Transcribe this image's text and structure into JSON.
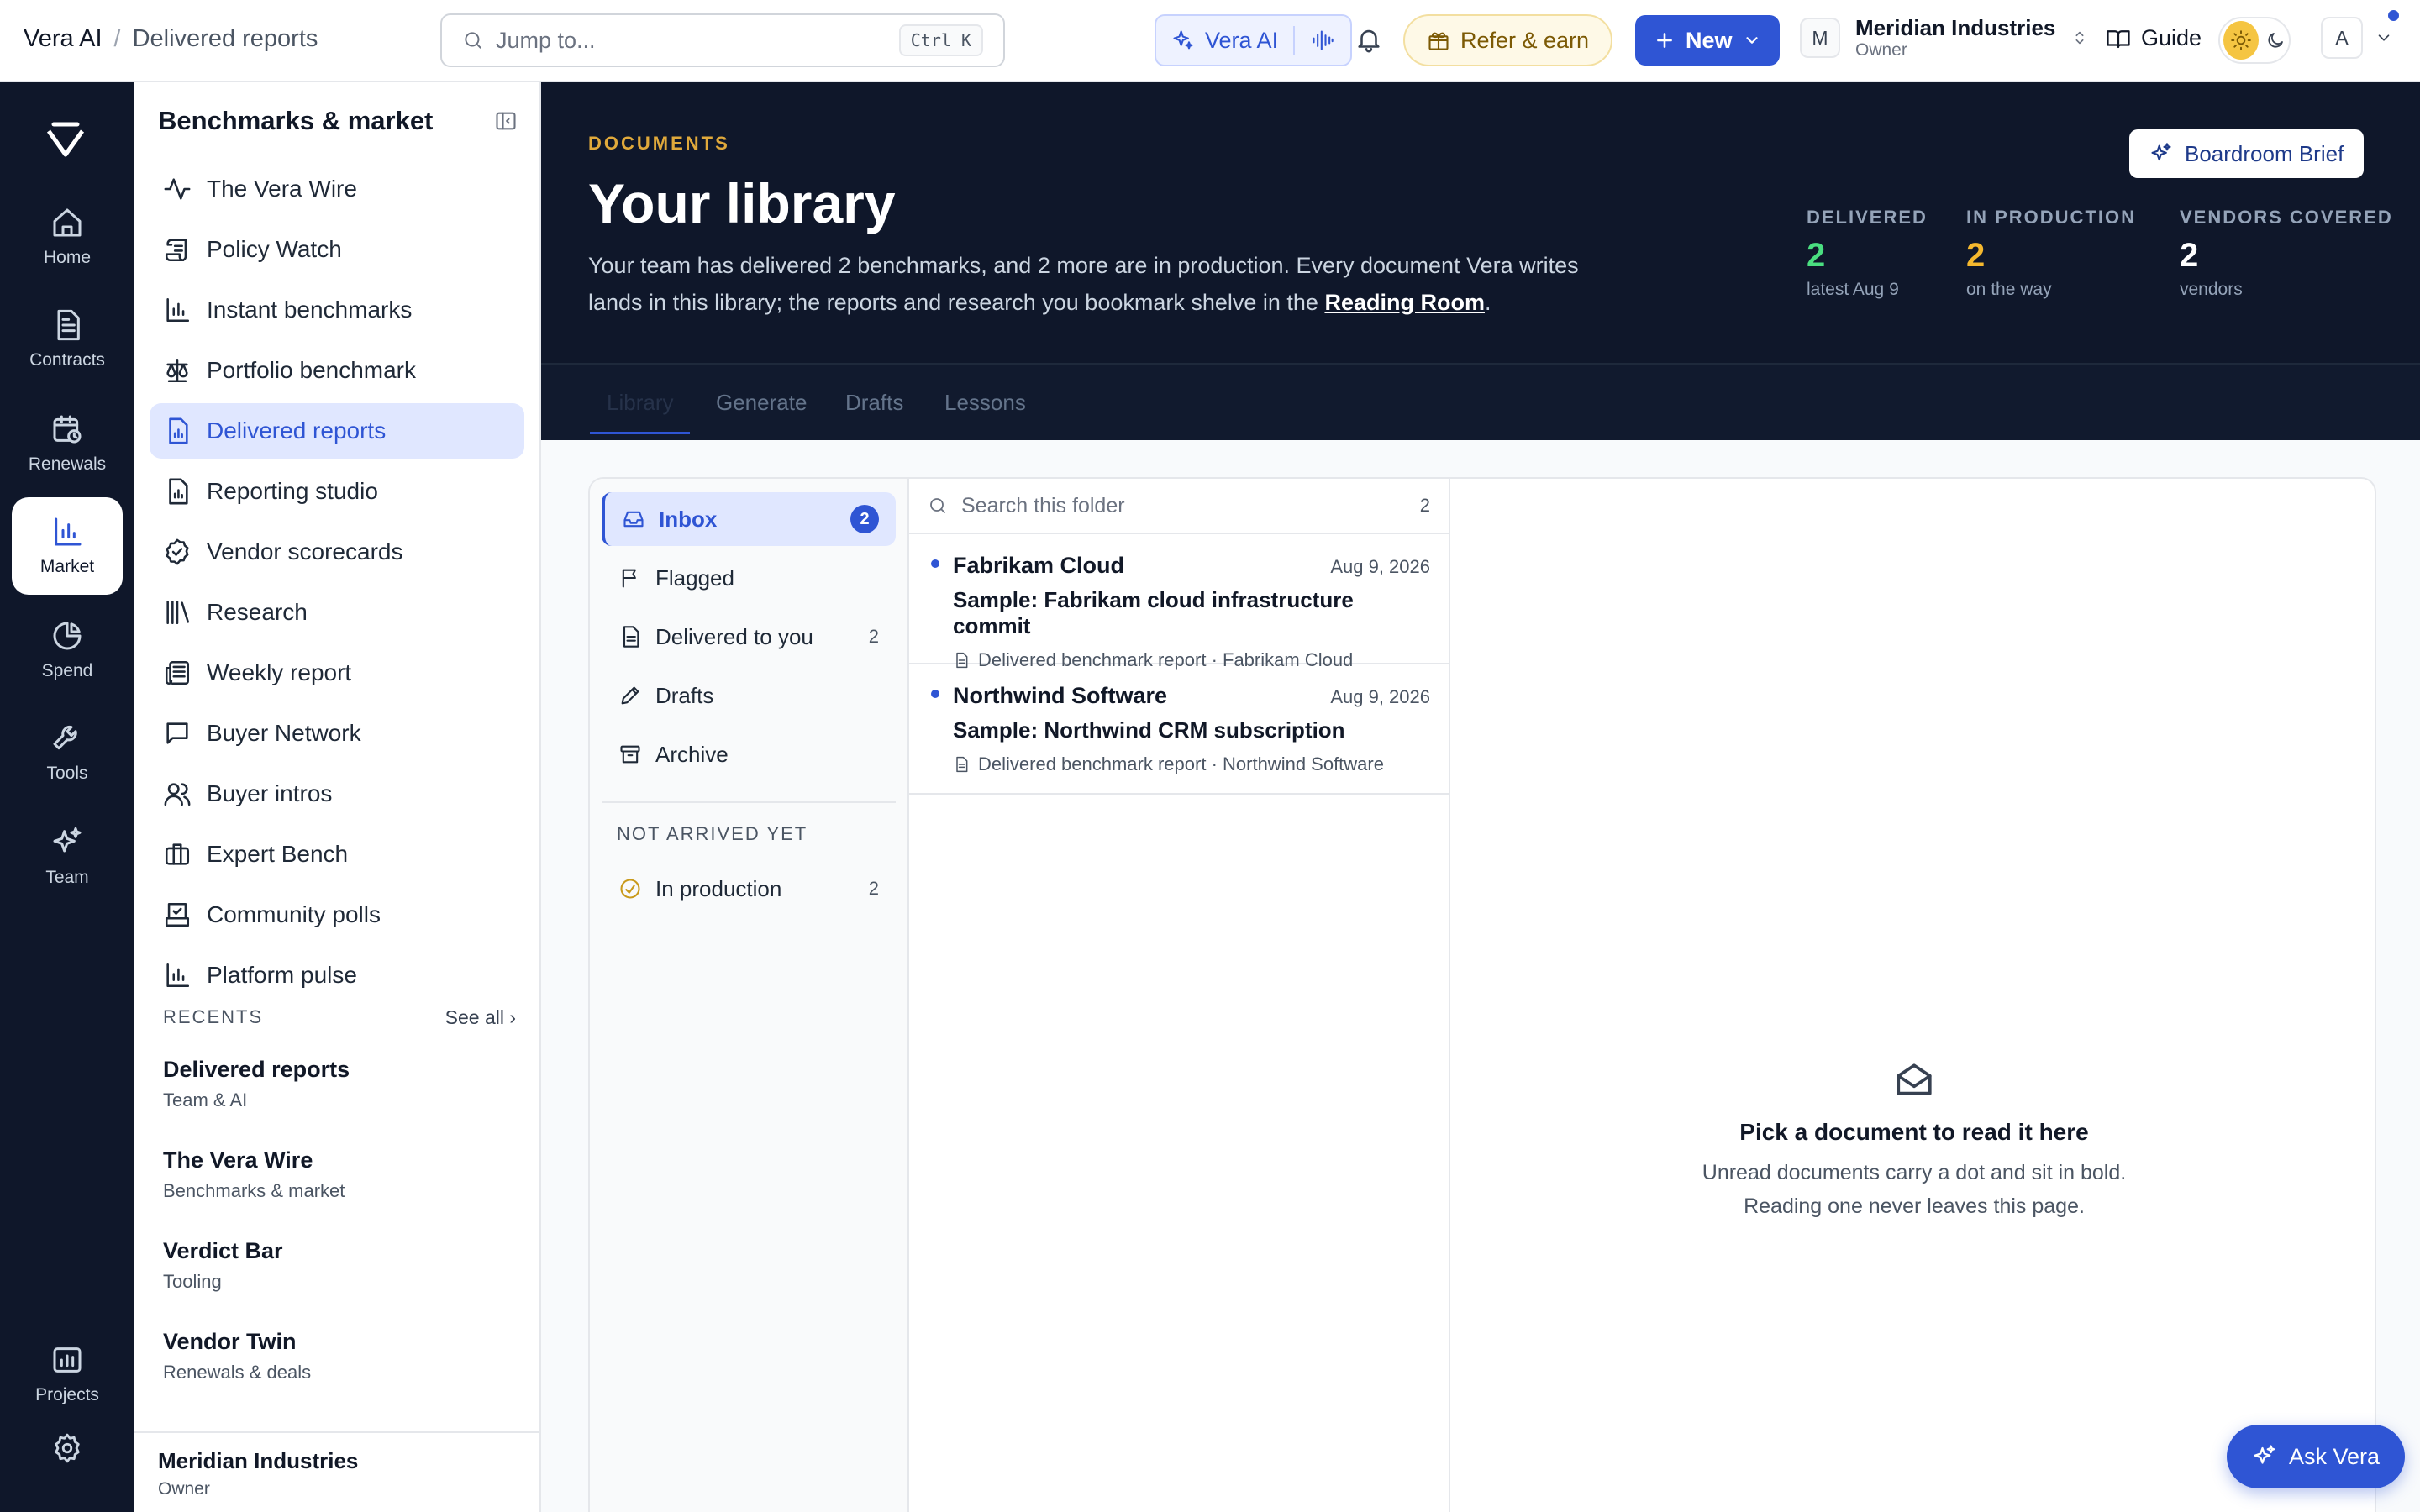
{
  "topbar": {
    "app_name": "Vera AI",
    "breadcrumb_sep": "/",
    "breadcrumb_current": "Delivered reports",
    "search_placeholder": "Jump to...",
    "search_shortcut": "Ctrl K",
    "vera_label": "Vera AI",
    "refer_label": "Refer & earn",
    "new_label": "New",
    "org_initial": "M",
    "org_name": "Meridian Industries",
    "org_role": "Owner",
    "guide_label": "Guide",
    "user_initial": "A"
  },
  "rail": {
    "items": [
      {
        "label": "Home",
        "icon": "home-icon"
      },
      {
        "label": "Contracts",
        "icon": "document-icon"
      },
      {
        "label": "Renewals",
        "icon": "calendar-clock-icon"
      },
      {
        "label": "Market",
        "icon": "bar-chart-icon"
      },
      {
        "label": "Spend",
        "icon": "pie-chart-icon"
      },
      {
        "label": "Tools",
        "icon": "wrench-icon"
      },
      {
        "label": "Team",
        "icon": "sparkles-icon"
      },
      {
        "label": "Projects",
        "icon": "folder-chart-icon"
      }
    ],
    "active": "Market"
  },
  "sidebar": {
    "title": "Benchmarks & market",
    "items": [
      {
        "label": "The Vera Wire",
        "icon": "activity-icon"
      },
      {
        "label": "Policy Watch",
        "icon": "scroll-icon"
      },
      {
        "label": "Instant benchmarks",
        "icon": "bar-chart-icon"
      },
      {
        "label": "Portfolio benchmark",
        "icon": "scale-icon"
      },
      {
        "label": "Delivered reports",
        "icon": "file-chart-icon"
      },
      {
        "label": "Reporting studio",
        "icon": "file-chart-icon"
      },
      {
        "label": "Vendor scorecards",
        "icon": "badge-check-icon"
      },
      {
        "label": "Research",
        "icon": "library-icon"
      },
      {
        "label": "Weekly report",
        "icon": "newspaper-icon"
      },
      {
        "label": "Buyer Network",
        "icon": "message-square-icon"
      },
      {
        "label": "Buyer intros",
        "icon": "users-icon"
      },
      {
        "label": "Expert Bench",
        "icon": "briefcase-icon"
      },
      {
        "label": "Community polls",
        "icon": "vote-icon"
      },
      {
        "label": "Platform pulse",
        "icon": "bar-chart-icon"
      }
    ],
    "active": "Delivered reports",
    "recents_heading": "RECENTS",
    "see_all": "See all ›",
    "recents": [
      {
        "title": "Delivered reports",
        "sub": "Team & AI"
      },
      {
        "title": "The Vera Wire",
        "sub": "Benchmarks & market"
      },
      {
        "title": "Verdict Bar",
        "sub": "Tooling"
      },
      {
        "title": "Vendor Twin",
        "sub": "Renewals & deals"
      }
    ],
    "footer_name": "Meridian Industries",
    "footer_role": "Owner"
  },
  "hero": {
    "eyebrow": "DOCUMENTS",
    "title": "Your library",
    "desc_before": "Your team has delivered 2 benchmarks, and 2 more are in production. Every document Vera writes lands in this library; the reports and research you bookmark shelve in the ",
    "desc_link": "Reading Room",
    "desc_after": ".",
    "boardroom_label": "Boardroom Brief",
    "stats": [
      {
        "key": "DELIVERED",
        "value": "2",
        "sub": "latest Aug 9",
        "color": "#4ade80"
      },
      {
        "key": "IN PRODUCTION",
        "value": "2",
        "sub": "on the way",
        "color": "#f5b82e"
      },
      {
        "key": "VENDORS COVERED",
        "value": "2",
        "sub": "vendors",
        "color": "#ffffff"
      }
    ],
    "tabs": [
      "Library",
      "Generate",
      "Drafts",
      "Lessons"
    ],
    "active_tab": "Library"
  },
  "folders": {
    "items": [
      {
        "label": "Inbox",
        "badge": "2",
        "icon": "inbox-icon"
      },
      {
        "label": "Flagged",
        "count": "",
        "icon": "flag-icon"
      },
      {
        "label": "Delivered to you",
        "count": "2",
        "icon": "document-icon"
      },
      {
        "label": "Drafts",
        "count": "",
        "icon": "pencil-icon"
      },
      {
        "label": "Archive",
        "count": "",
        "icon": "archive-icon"
      }
    ],
    "not_arrived_heading": "NOT ARRIVED YET",
    "in_production": {
      "label": "In production",
      "count": "2"
    }
  },
  "doclist": {
    "search_placeholder": "Search this folder",
    "count": "2",
    "docs": [
      {
        "vendor": "Fabrikam Cloud",
        "date": "Aug 9, 2026",
        "subject": "Sample: Fabrikam cloud infrastructure commit",
        "meta": "Delivered benchmark report · Fabrikam Cloud",
        "unread": true
      },
      {
        "vendor": "Northwind Software",
        "date": "Aug 9, 2026",
        "subject": "Sample: Northwind CRM subscription",
        "meta": "Delivered benchmark report · Northwind Software",
        "unread": true
      }
    ]
  },
  "reader": {
    "empty_title": "Pick a document to read it here",
    "empty_line1": "Unread documents carry a dot and sit in bold.",
    "empty_line2": "Reading one never leaves this page."
  },
  "ask_vera_label": "Ask Vera",
  "colors": {
    "accent": "#2f55d4",
    "navy": "#0f172a",
    "gold": "#e0a93b"
  }
}
